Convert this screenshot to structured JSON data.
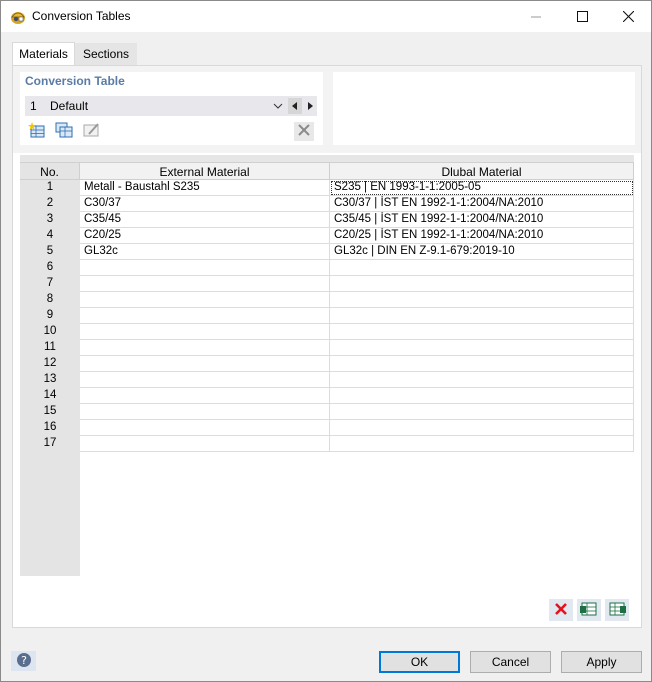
{
  "window": {
    "title": "Conversion Tables"
  },
  "tabs": [
    {
      "label": "Materials"
    },
    {
      "label": "Sections"
    }
  ],
  "conversion": {
    "section_title": "Conversion Table",
    "selected_number": "1",
    "selected_name": "Default"
  },
  "table": {
    "headers": {
      "no": "No.",
      "external": "External Material",
      "dlubal": "Dlubal Material"
    },
    "rows": [
      {
        "no": "1",
        "external": "Metall - Baustahl S235",
        "dlubal": "S235 | EN 1993-1-1:2005-05"
      },
      {
        "no": "2",
        "external": "C30/37",
        "dlubal": "C30/37 | ÍST EN 1992-1-1:2004/NA:2010"
      },
      {
        "no": "3",
        "external": "C35/45",
        "dlubal": "C35/45 | ÍST EN 1992-1-1:2004/NA:2010"
      },
      {
        "no": "4",
        "external": "C20/25",
        "dlubal": "C20/25 | ÍST EN 1992-1-1:2004/NA:2010"
      },
      {
        "no": "5",
        "external": "GL32c",
        "dlubal": "GL32c | DIN EN Z-9.1-679:2019-10"
      },
      {
        "no": "6",
        "external": "",
        "dlubal": ""
      },
      {
        "no": "7",
        "external": "",
        "dlubal": ""
      },
      {
        "no": "8",
        "external": "",
        "dlubal": ""
      },
      {
        "no": "9",
        "external": "",
        "dlubal": ""
      },
      {
        "no": "10",
        "external": "",
        "dlubal": ""
      },
      {
        "no": "11",
        "external": "",
        "dlubal": ""
      },
      {
        "no": "12",
        "external": "",
        "dlubal": ""
      },
      {
        "no": "13",
        "external": "",
        "dlubal": ""
      },
      {
        "no": "14",
        "external": "",
        "dlubal": ""
      },
      {
        "no": "15",
        "external": "",
        "dlubal": ""
      },
      {
        "no": "16",
        "external": "",
        "dlubal": ""
      },
      {
        "no": "17",
        "external": "",
        "dlubal": ""
      }
    ]
  },
  "buttons": {
    "ok": "OK",
    "cancel": "Cancel",
    "apply": "Apply"
  },
  "icons": {
    "app": "rfem-helmet-icon",
    "new_table": "new-table-icon",
    "copy_table": "copy-table-icon",
    "rename_table": "rename-table-icon",
    "delete_table": "delete-icon",
    "delete_rows": "red-x-icon",
    "import": "import-excel-icon",
    "export": "export-excel-icon",
    "help": "help-icon"
  },
  "colors": {
    "accent": "#5a7ba6",
    "ok_border": "#0078d7",
    "delete_red": "#e8111a"
  }
}
